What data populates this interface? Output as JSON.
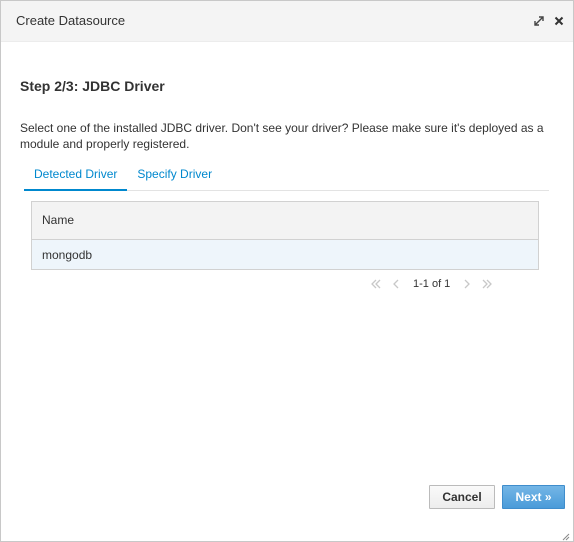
{
  "dialog": {
    "title": "Create Datasource",
    "icons": [
      "expand-icon",
      "close-icon"
    ]
  },
  "step": {
    "title": "Step 2/3: JDBC Driver",
    "description": "Select one of the installed JDBC driver. Don't see your driver? Please make sure it's deployed as a module and properly registered."
  },
  "tabs": [
    {
      "label": "Detected Driver",
      "active": true
    },
    {
      "label": "Specify Driver",
      "active": false
    }
  ],
  "table": {
    "columns": [
      "Name"
    ],
    "rows": [
      {
        "name": "mongodb",
        "selected": true
      }
    ]
  },
  "pager": {
    "text": "1-1 of 1"
  },
  "footer": {
    "cancel_label": "Cancel",
    "next_label": "Next »"
  },
  "colors": {
    "accent": "#0088ce",
    "primary_button": "#4a9bd9",
    "selected_row": "#eef5fb"
  }
}
